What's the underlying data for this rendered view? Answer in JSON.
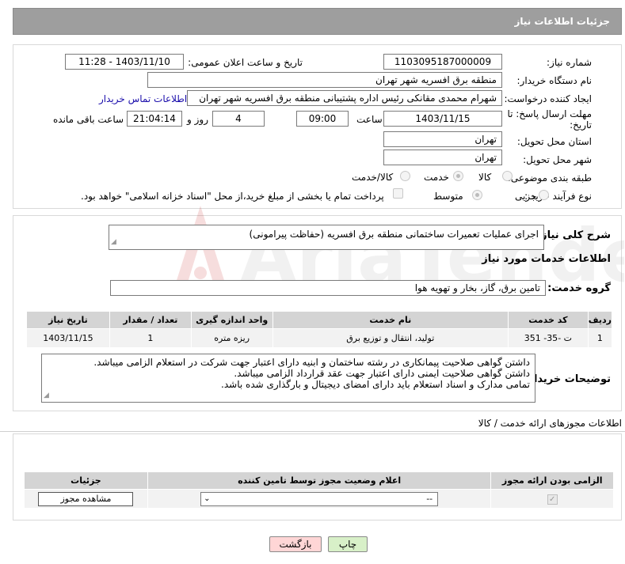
{
  "header": {
    "title": "جزئیات اطلاعات نیاز"
  },
  "form": {
    "need_number_label": "شماره نیاز:",
    "need_number": "1103095187000009",
    "announce_label": "تاریخ و ساعت اعلان عمومی:",
    "announce_value": "1403/11/10 - 11:28",
    "buyer_org_label": "نام دستگاه خریدار:",
    "buyer_org": "منطقه برق افسریه شهر تهران",
    "requester_label": "ایجاد کننده درخواست:",
    "requester": "شهرام محمدی مقانکی رئیس اداره پشتیبانی منطقه برق افسریه شهر تهران",
    "contact_link": "اطلاعات تماس خریدار",
    "deadline_label_1": "مهلت ارسال پاسخ: تا",
    "deadline_label_2": "تاریخ:",
    "deadline_date": "1403/11/15",
    "time_label": "ساعت",
    "deadline_time": "09:00",
    "days_value": "4",
    "days_label": "روز و",
    "remaining_time": "21:04:14",
    "remaining_label": "ساعت باقی مانده",
    "province_label": "استان محل تحویل:",
    "province": "تهران",
    "city_label": "شهر محل تحویل:",
    "city": "تهران",
    "category_label": "طبقه بندی موضوعی:",
    "category_options": [
      "کالا",
      "خدمت",
      "کالا/خدمت"
    ],
    "category_selected": "خدمت",
    "process_label": "نوع فرآیند خرید :",
    "process_options": [
      "جزیی",
      "متوسط"
    ],
    "process_selected": "متوسط",
    "payment_note": "پرداخت تمام یا بخشی از مبلغ خرید،از محل \"اسناد خزانه اسلامی\" خواهد بود."
  },
  "summary": {
    "label": "شرح کلی نیاز:",
    "value": "اجرای عملیات  تعمیرات ساختمانی منطقه برق افسریه (حفاظت پیرامونی)"
  },
  "services": {
    "section_title": "اطلاعات خدمات مورد نیاز",
    "group_label": "گروه خدمت:",
    "group_value": "تامین برق، گاز، بخار و تهویه هوا",
    "columns": [
      "ردیف",
      "کد خدمت",
      "نام خدمت",
      "واحد اندازه گیری",
      "تعداد / مقدار",
      "تاریخ نیاز"
    ],
    "rows": [
      [
        "1",
        "ت -35- 351",
        "تولید، انتقال و توزیع برق",
        "ریزه متره",
        "1",
        "1403/11/15"
      ]
    ]
  },
  "buyer_notes": {
    "label": "توضیحات خریدار:",
    "lines": [
      "داشتن گواهی صلاحیت پیمانکاری در رشته ساختمان و ابنیه  دارای اعتبار جهت شرکت در استعلام الزامی میباشد.",
      "داشتن گواهی صلاحیت ایمنی دارای اعتبار  جهت عقد قرارداد الزامی میباشد.",
      "تمامی مدارک و اسناد استعلام باید دارای امضای دیجیتال و بارگذاری شده باشد."
    ]
  },
  "permits": {
    "section_title": "اطلاعات مجوزهای ارائه خدمت / کالا",
    "columns": [
      "الزامی بودن ارائه مجوز",
      "اعلام وضعیت مجوز توسط تامین کننده",
      "جزئیات"
    ],
    "status_value": "--",
    "view_button": "مشاهده مجوز"
  },
  "actions": {
    "print": "چاپ",
    "back": "بازگشت"
  },
  "watermark_text": "AriaTender.neT",
  "colors": {
    "header_bg": "#9e9e9e",
    "link": "#1a0dab",
    "back_btn": "#ffd6d6",
    "print_btn": "#d8f0c8"
  }
}
